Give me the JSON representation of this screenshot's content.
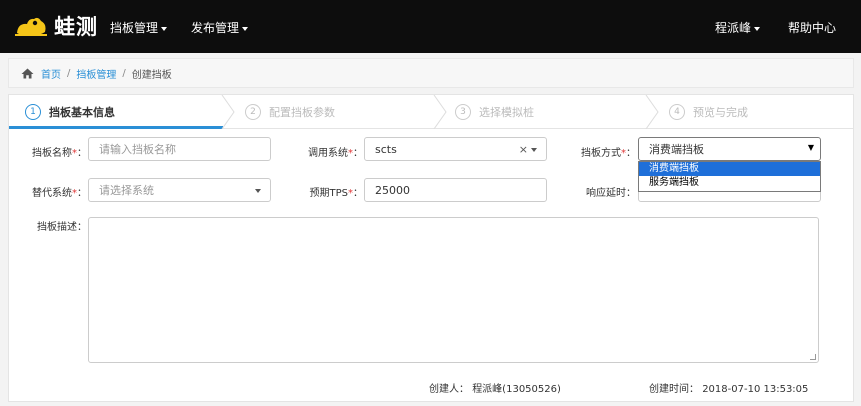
{
  "navbar": {
    "brand": "蛙测",
    "menu": [
      {
        "label": "挡板管理"
      },
      {
        "label": "发布管理"
      }
    ],
    "user": "程派峰",
    "help": "帮助中心"
  },
  "breadcrumb": {
    "home": "首页",
    "parent": "挡板管理",
    "current": "创建挡板",
    "sep": "/"
  },
  "steps": [
    {
      "num": "1",
      "label": "挡板基本信息"
    },
    {
      "num": "2",
      "label": "配置挡板参数"
    },
    {
      "num": "3",
      "label": "选择模拟桩"
    },
    {
      "num": "4",
      "label": "预览与完成"
    }
  ],
  "form": {
    "name": {
      "label": "挡板名称",
      "required": "*",
      "colon": "：",
      "placeholder": "请输入挡板名称"
    },
    "system": {
      "label": "调用系统",
      "required": "*",
      "colon": "：",
      "value": "scts",
      "clear": "×"
    },
    "mode": {
      "label": "挡板方式",
      "required": "*",
      "colon": "：",
      "value": "消费端挡板",
      "arrow": "▼",
      "options": [
        "消费端挡板",
        "服务端挡板"
      ]
    },
    "alt_system": {
      "label": "替代系统",
      "required": "*",
      "colon": "：",
      "placeholder": "请选择系统"
    },
    "tps": {
      "label": "预期TPS",
      "required": "*",
      "colon": "：",
      "value": "25000"
    },
    "delay": {
      "label": "响应延时",
      "colon": "："
    },
    "desc": {
      "label": "挡板描述",
      "colon": "："
    }
  },
  "footer": {
    "creator_label": "创建人：",
    "creator": "程派峰(13050526)",
    "time_label": "创建时间：",
    "time": "2018-07-10 13:53:05"
  },
  "colors": {
    "accent": "#2a8fd6",
    "navbar": "#0d0d0d",
    "required": "#e03535",
    "selected_option": "#1e6fd9",
    "logo": "#f5c518"
  }
}
